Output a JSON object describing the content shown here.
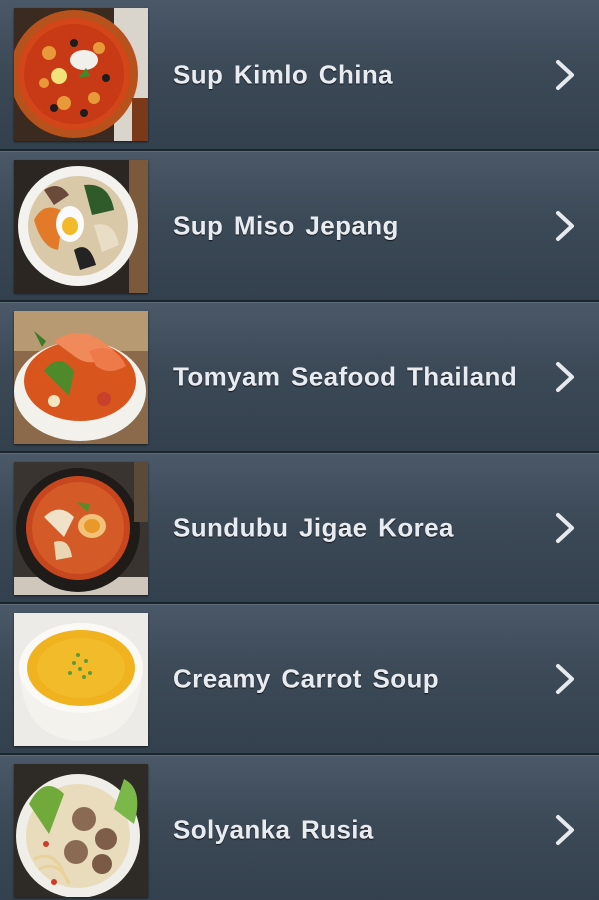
{
  "items": [
    {
      "label": "Sup Kimlo China",
      "icon": "chevron-right-icon"
    },
    {
      "label": "Sup Miso Jepang",
      "icon": "chevron-right-icon"
    },
    {
      "label": "Tomyam Seafood Thailand",
      "icon": "chevron-right-icon"
    },
    {
      "label": "Sundubu Jigae Korea",
      "icon": "chevron-right-icon"
    },
    {
      "label": "Creamy Carrot Soup",
      "icon": "chevron-right-icon"
    },
    {
      "label": "Solyanka Rusia",
      "icon": "chevron-right-icon"
    }
  ]
}
